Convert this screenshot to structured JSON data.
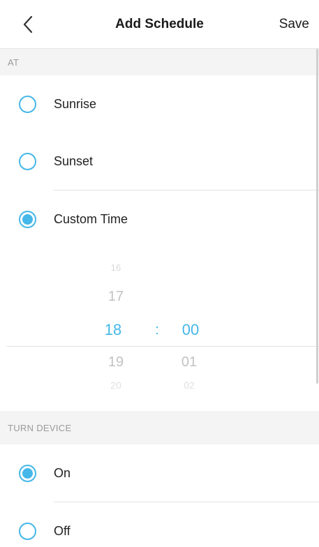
{
  "header": {
    "title": "Add Schedule",
    "save_label": "Save",
    "back_icon": "chevron-left-icon"
  },
  "at_section": {
    "label": "AT",
    "options": [
      {
        "label": "Sunrise",
        "selected": false
      },
      {
        "label": "Sunset",
        "selected": false
      },
      {
        "label": "Custom Time",
        "selected": true
      }
    ]
  },
  "time_picker": {
    "hours": [
      "16",
      "17",
      "18",
      "19",
      "20"
    ],
    "minutes": [
      "",
      "",
      "00",
      "01",
      "02"
    ],
    "selected_hour": "18",
    "selected_minute": "00",
    "separator": ":"
  },
  "turn_device_section": {
    "label": "TURN DEVICE",
    "options": [
      {
        "label": "On",
        "selected": true
      },
      {
        "label": "Off",
        "selected": false
      }
    ]
  },
  "colors": {
    "accent": "#45b7e8",
    "section_bg": "#f4f4f4",
    "divider": "#e2e2e2"
  }
}
